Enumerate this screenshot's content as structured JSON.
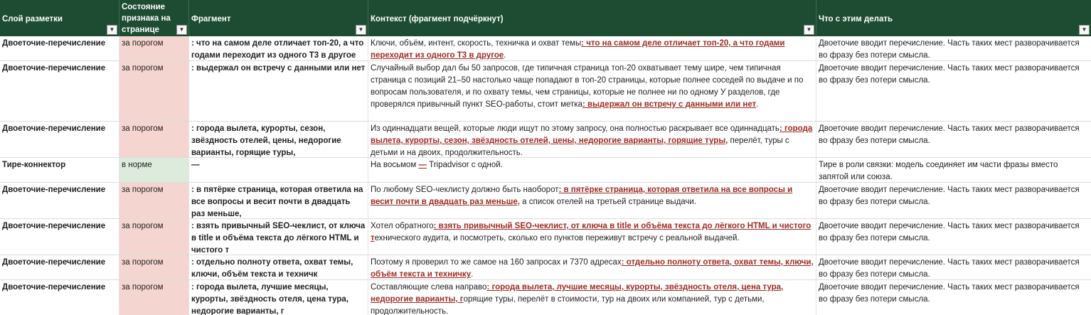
{
  "columns": [
    {
      "label": "Слой разметки",
      "filter": "filter-applied-icon"
    },
    {
      "label": "Состояние признака на странице",
      "filter": "dropdown-arrow-icon"
    },
    {
      "label": "Фрагмент",
      "filter": "dropdown-arrow-icon"
    },
    {
      "label": "Контекст (фрагмент подчёркнут)",
      "filter": "dropdown-arrow-icon"
    },
    {
      "label": "Что с этим делать",
      "filter": "dropdown-arrow-icon"
    }
  ],
  "colors": {
    "header_bg": "#1e4c33",
    "status_over": "#f5d5cf",
    "status_normal": "#dcebdc",
    "underline_text": "#9c2b22"
  },
  "rows": [
    {
      "layer": "Двоеточие-перечисление",
      "status": "за порогом",
      "fragment": ": что на самом деле отличает топ-20, а что годами переходит из одного Т3 в другое",
      "ctx_before": "Ключи, объём, интент, скорость, техничка и охват темы",
      "ctx_mark": ": что на самом деле отличает топ-20, а что годами переходит из одного Т3 в другое",
      "ctx_after": ".",
      "action": "Двоеточие вводит перечисление. Часть таких мест разворачивается во фразу без потери смысла."
    },
    {
      "layer": "Двоеточие-перечисление",
      "status": "за порогом",
      "fragment": ": выдержал он встречу с данными или нет",
      "ctx_before": "Случайный выбор дал бы 50  запросов, где типичная страница топ-20 охватывает тему шире, чем типичная страница с позиций 21–50  настолько чаще попадают в топ-20 страницы, которые полнее соседей по выдаче и по вопросам пользователя, и по охвату темы, чем страницы, которые не полнее ни по одному  У разделов, где проверялся привычный пункт SEO-работы, стоит метка",
      "ctx_mark": ": выдержал он встречу с данными или нет",
      "ctx_after": ".",
      "action": "Двоеточие вводит перечисление. Часть таких мест разворачивается во фразу без потери смысла."
    },
    {
      "layer": "Двоеточие-перечисление",
      "status": "за порогом",
      "fragment": ": города вылета, курорты, сезон, звёздность отелей, цены, недорогие варианты, горящие туры,",
      "ctx_before": "Из одиннадцати вещей, которые люди ищут по этому запросу, она полностью раскрывает все одиннадцать",
      "ctx_mark": ": города вылета, курорты, сезон, звёздность отелей, цены, недорогие варианты, горящие туры,",
      "ctx_after": " перелёт, туры с детьми и на двоих, продолжительность.",
      "action": "Двоеточие вводит перечисление. Часть таких мест разворачивается во фразу без потери смысла."
    },
    {
      "layer": "Тире-коннектор",
      "status": "в норме",
      "fragment": "—",
      "ctx_before": "На восьмом ",
      "ctx_mark": "—",
      "ctx_after": " Tripadvisor с одной.",
      "action": "Тире в роли связки: модель соединяет им части фразы вместо запятой или союза."
    },
    {
      "layer": "Двоеточие-перечисление",
      "status": "за порогом",
      "fragment": ": в пятёрке страница, которая ответила на все вопросы и весит почти в двадцать раз меньше,",
      "ctx_before": "По любому SEO-чеклисту должно быть наоборот",
      "ctx_mark": ": в пятёрке страница, которая ответила на все вопросы и весит почти в двадцать раз меньше,",
      "ctx_after": " а список отелей на третьей странице выдачи.",
      "action": "Двоеточие вводит перечисление. Часть таких мест разворачивается во фразу без потери смысла."
    },
    {
      "layer": "Двоеточие-перечисление",
      "status": "за порогом",
      "fragment": ": взять привычный SEO-чеклист, от ключа в title и объёма текста до лёгкого HTML и чистого т",
      "ctx_before": "Хотел обратного",
      "ctx_mark": ": взять привычный SEO-чеклист, от ключа в title и объёма текста до лёгкого HTML и чистого т",
      "ctx_after": "ехнического аудита, и посмотреть, сколько его пунктов переживут встречу с реальной выдачей.",
      "action": "Двоеточие вводит перечисление. Часть таких мест разворачивается во фразу без потери смысла."
    },
    {
      "layer": "Двоеточие-перечисление",
      "status": "за порогом",
      "fragment": ": отдельно полноту ответа, охват темы, ключи, объём текста и техничк",
      "ctx_before": "Поэтому я проверил то же самое на 160 запросах и 7370 адресах",
      "ctx_mark": ": отдельно полноту ответа, охват темы, ключи, объём текста и техничку",
      "ctx_after": ".",
      "action": "Двоеточие вводит перечисление. Часть таких мест разворачивается во фразу без потери смысла."
    },
    {
      "layer": "Двоеточие-перечисление",
      "status": "за порогом",
      "fragment": ": города вылета, лучшие месяцы, курорты, звёздность отеля, цена тура, недорогие варианты, г",
      "ctx_before": "Составляющие слева направо",
      "ctx_mark": ": города вылета, лучшие месяцы, курорты, звёздность отеля, цена тура, недорогие варианты, г",
      "ctx_after": "орящие туры, перелёт в стоимости, тур на двоих или компанией, тур с детьми, продолжительность.",
      "action": "Двоеточие вводит перечисление. Часть таких мест разворачивается во фразу без потери смысла."
    }
  ]
}
